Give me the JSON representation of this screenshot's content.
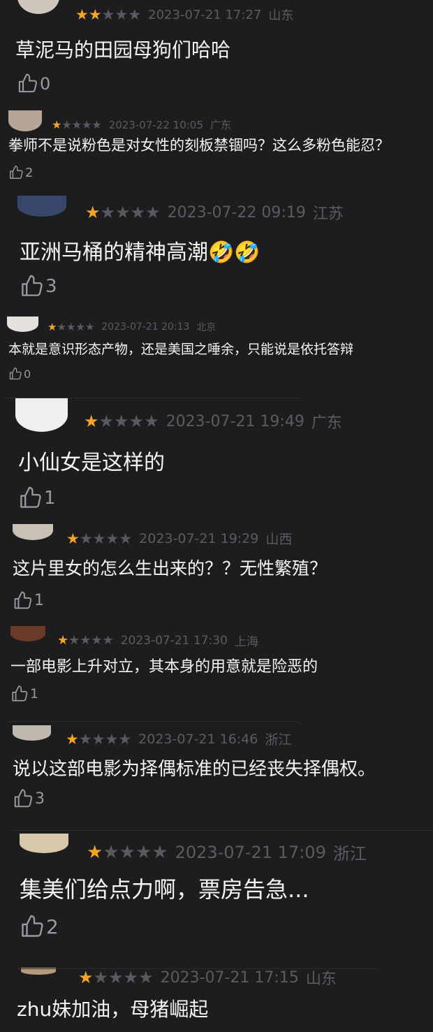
{
  "theme": {
    "background": "#1d1d1f",
    "star_on": "#f5a524",
    "star_off": "#5a5a5e",
    "meta_text": "#5c5c60",
    "comment_text": "#f4f4f4"
  },
  "comments": [
    {
      "rating": 2,
      "date": "2023-07-21 17:27",
      "region": "山东",
      "text": "草泥马的田园母狗们哈哈",
      "likes": "0",
      "avatar_icon": "avatar-icon"
    },
    {
      "rating": 1,
      "date": "2023-07-22 10:05",
      "region": "广东",
      "text": "拳师不是说粉色是对女性的刻板禁锢吗？这么多粉色能忍？",
      "likes": "2",
      "avatar_icon": "avatar-icon"
    },
    {
      "rating": 1,
      "date": "2023-07-22 09:19",
      "region": "江苏",
      "text": "亚洲马桶的精神高潮🤣🤣",
      "likes": "3",
      "avatar_icon": "avatar-icon"
    },
    {
      "rating": 1,
      "date": "2023-07-21 20:13",
      "region": "北京",
      "text": "本就是意识形态产物，还是美国之唾余，只能说是依托答辩",
      "likes": "0",
      "avatar_icon": "avatar-icon"
    },
    {
      "rating": 1,
      "date": "2023-07-21 19:49",
      "region": "广东",
      "text": "小仙女是这样的",
      "likes": "1",
      "avatar_icon": "avatar-icon"
    },
    {
      "rating": 1,
      "date": "2023-07-21 19:29",
      "region": "山西",
      "text": "这片里女的怎么生出来的？？无性繁殖？",
      "likes": "1",
      "avatar_icon": "avatar-icon"
    },
    {
      "rating": 1,
      "date": "2023-07-21 17:30",
      "region": "上海",
      "text": "一部电影上升对立，其本身的用意就是险恶的",
      "likes": "1",
      "avatar_icon": "avatar-icon"
    },
    {
      "rating": 1,
      "date": "2023-07-21 16:46",
      "region": "浙江",
      "text": "说以这部电影为择偶标准的已经丧失择偶权。",
      "likes": "3",
      "avatar_icon": "avatar-icon"
    },
    {
      "rating": 1,
      "date": "2023-07-21 17:09",
      "region": "浙江",
      "text": "集美们给点力啊，票房告急...",
      "likes": "2",
      "avatar_icon": "avatar-icon"
    },
    {
      "rating": 1,
      "date": "2023-07-21 17:15",
      "region": "山东",
      "text": "zhu妹加油，母猪崛起",
      "likes": "",
      "avatar_icon": "avatar-icon"
    }
  ]
}
